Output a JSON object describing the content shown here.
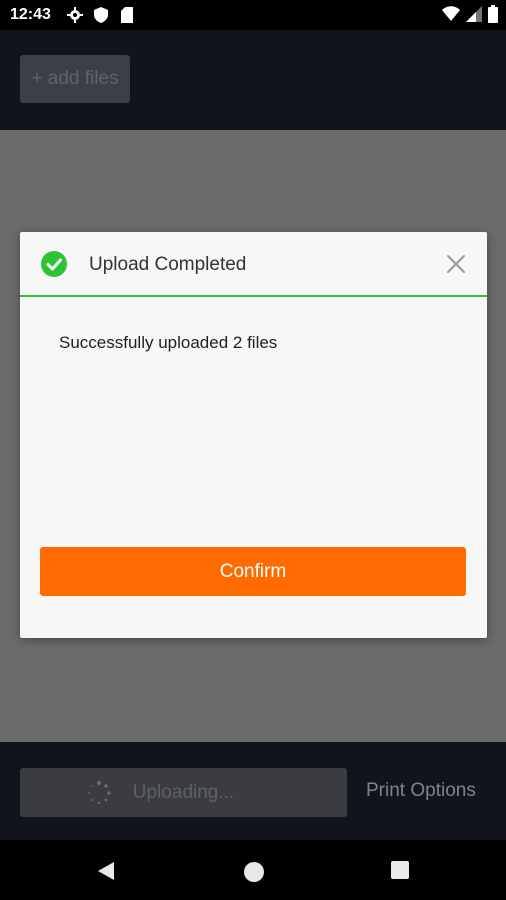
{
  "status_bar": {
    "time": "12:43",
    "left_icons": [
      "gear-icon",
      "shield-icon",
      "sd-card-icon"
    ],
    "right_icons": [
      "wifi-icon",
      "signal-icon",
      "battery-icon"
    ]
  },
  "header": {
    "add_files_label": "+ add files"
  },
  "bottom_bar": {
    "uploading_label": "Uploading...",
    "print_options_label": "Print Options"
  },
  "dialog": {
    "title": "Upload Completed",
    "message": "Successfully uploaded 2 files",
    "confirm_label": "Confirm",
    "accent_color": "#2ec236",
    "confirm_color": "#ff6b00"
  },
  "nav_bar": {
    "buttons": [
      "back-icon",
      "home-icon",
      "recents-icon"
    ]
  }
}
